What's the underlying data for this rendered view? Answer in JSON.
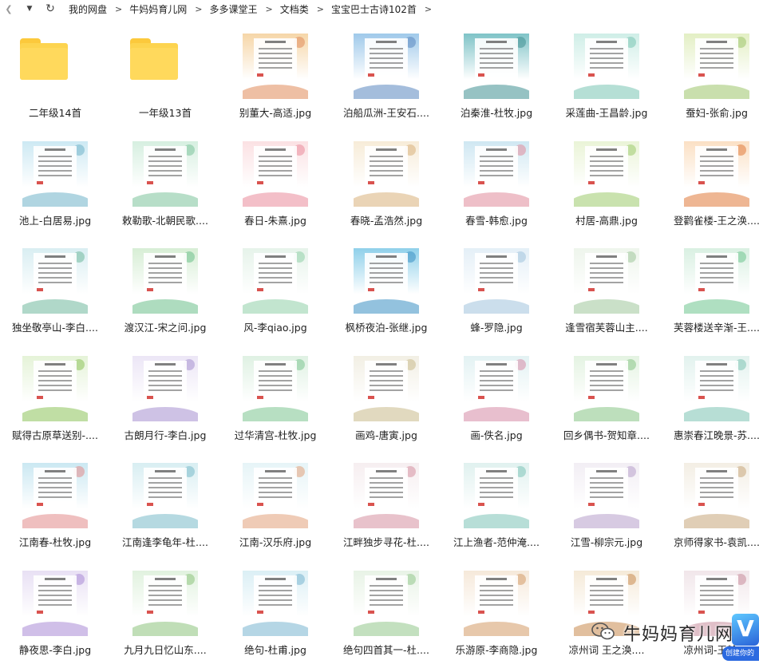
{
  "toolbar": {
    "back_icon": "chevron-left-icon",
    "dropdown_icon": "caret-down-icon",
    "refresh_icon": "refresh-icon",
    "breadcrumb": [
      "我的网盘",
      "牛妈妈育儿网",
      "多多课堂王",
      "文档类",
      "宝宝巴士古诗102首"
    ],
    "separator": ">"
  },
  "items": [
    {
      "name": "二年级14首",
      "type": "folder"
    },
    {
      "name": "一年级13首",
      "type": "folder"
    },
    {
      "name": "别董大-高适.jpg",
      "type": "image",
      "color": "#f6d6a8",
      "accent": "#e08a5a"
    },
    {
      "name": "泊船瓜洲-王安石....",
      "type": "image",
      "color": "#9fc9ea",
      "accent": "#5a86c0"
    },
    {
      "name": "泊秦淮-杜牧.jpg",
      "type": "image",
      "color": "#7fc3c7",
      "accent": "#3f8f92"
    },
    {
      "name": "采莲曲-王昌龄.jpg",
      "type": "image",
      "color": "#cfeee7",
      "accent": "#79c4b2"
    },
    {
      "name": "蚕妇-张俞.jpg",
      "type": "image",
      "color": "#e3efc4",
      "accent": "#9cc46a"
    },
    {
      "name": "池上-白居易.jpg",
      "type": "image",
      "color": "#cde9f3",
      "accent": "#6fb3c9"
    },
    {
      "name": "敕勒歌-北朝民歌....",
      "type": "image",
      "color": "#d6efe0",
      "accent": "#7cc39a"
    },
    {
      "name": "春日-朱熹.jpg",
      "type": "image",
      "color": "#fbe1e3",
      "accent": "#e98a9a"
    },
    {
      "name": "春晓-孟浩然.jpg",
      "type": "image",
      "color": "#f7ecd8",
      "accent": "#d8b17a"
    },
    {
      "name": "春雪-韩愈.jpg",
      "type": "image",
      "color": "#cfe7f2",
      "accent": "#e08a9a"
    },
    {
      "name": "村居-高鼎.jpg",
      "type": "image",
      "color": "#eaf4d7",
      "accent": "#9ccb6b"
    },
    {
      "name": "登鹳雀楼-王之涣....",
      "type": "image",
      "color": "#fbe0c4",
      "accent": "#e07a3a"
    },
    {
      "name": "独坐敬亭山-李白....",
      "type": "image",
      "color": "#d9eef2",
      "accent": "#6fb89c"
    },
    {
      "name": "渡汉江-宋之问.jpg",
      "type": "image",
      "color": "#d7eed5",
      "accent": "#6cbf8a"
    },
    {
      "name": "风-李qiao.jpg",
      "type": "image",
      "color": "#e6f3ea",
      "accent": "#8fcfa8"
    },
    {
      "name": "枫桥夜泊-张继.jpg",
      "type": "image",
      "color": "#8fd0ea",
      "accent": "#3a8fc2"
    },
    {
      "name": "蜂-罗隐.jpg",
      "type": "image",
      "color": "#e4eff7",
      "accent": "#a0c2dc"
    },
    {
      "name": "逢雪宿芙蓉山主....",
      "type": "image",
      "color": "#eef5ec",
      "accent": "#9fc79a"
    },
    {
      "name": "芙蓉楼送辛渐-王....",
      "type": "image",
      "color": "#d9f0e2",
      "accent": "#6ec48e"
    },
    {
      "name": "赋得古原草送别-....",
      "type": "image",
      "color": "#e5f3d8",
      "accent": "#8cc35a"
    },
    {
      "name": "古朗月行-李白.jpg",
      "type": "image",
      "color": "#ece6f6",
      "accent": "#a58fd0"
    },
    {
      "name": "过华清宫-杜牧.jpg",
      "type": "image",
      "color": "#dff1e3",
      "accent": "#7cc48f"
    },
    {
      "name": "画鸡-唐寅.jpg",
      "type": "image",
      "color": "#f2efe4",
      "accent": "#c9b98a"
    },
    {
      "name": "画-佚名.jpg",
      "type": "image",
      "color": "#e3f2f3",
      "accent": "#d58aa5"
    },
    {
      "name": "回乡偶书-贺知章....",
      "type": "image",
      "color": "#e4f3e2",
      "accent": "#86c485"
    },
    {
      "name": "惠崇春江晚景-苏....",
      "type": "image",
      "color": "#e2f2ee",
      "accent": "#7cc3b2"
    },
    {
      "name": "江南春-杜牧.jpg",
      "type": "image",
      "color": "#cbe8f2",
      "accent": "#e28a8a"
    },
    {
      "name": "江南逢李龟年-杜....",
      "type": "image",
      "color": "#d8eef2",
      "accent": "#78b9c9"
    },
    {
      "name": "江南-汉乐府.jpg",
      "type": "image",
      "color": "#e6f4f7",
      "accent": "#e2a07a"
    },
    {
      "name": "江畔独步寻花-杜....",
      "type": "image",
      "color": "#f6eef0",
      "accent": "#d68fa0"
    },
    {
      "name": "江上渔者-范仲淹....",
      "type": "image",
      "color": "#e0f1ef",
      "accent": "#7cc2b6"
    },
    {
      "name": "江雪-柳宗元.jpg",
      "type": "image",
      "color": "#f2eef4",
      "accent": "#b79fcb"
    },
    {
      "name": "京师得家书-袁凯....",
      "type": "image",
      "color": "#f3eee4",
      "accent": "#c7a67a"
    },
    {
      "name": "静夜思-李白.jpg",
      "type": "image",
      "color": "#e8e0f4",
      "accent": "#a98bd6"
    },
    {
      "name": "九月九日忆山东....",
      "type": "image",
      "color": "#e1f2df",
      "accent": "#8cc37b"
    },
    {
      "name": "绝句-杜甫.jpg",
      "type": "image",
      "color": "#dbeff5",
      "accent": "#78b4d0"
    },
    {
      "name": "绝句四首其一-杜....",
      "type": "image",
      "color": "#e8f3e6",
      "accent": "#92c78a"
    },
    {
      "name": "乐游原-李商隐.jpg",
      "type": "image",
      "color": "#f6e9da",
      "accent": "#d49a66"
    },
    {
      "name": "凉州词 王之涣....",
      "type": "image",
      "color": "#f5ead8",
      "accent": "#c98a4e"
    },
    {
      "name": "凉州词-王翰....",
      "type": "image",
      "color": "#f1e6ea",
      "accent": "#c78b9a"
    }
  ],
  "watermark": {
    "text": "牛妈妈育儿网",
    "icon": "wechat-icon",
    "badge_letter": "V",
    "badge_sub": "创建你的"
  }
}
